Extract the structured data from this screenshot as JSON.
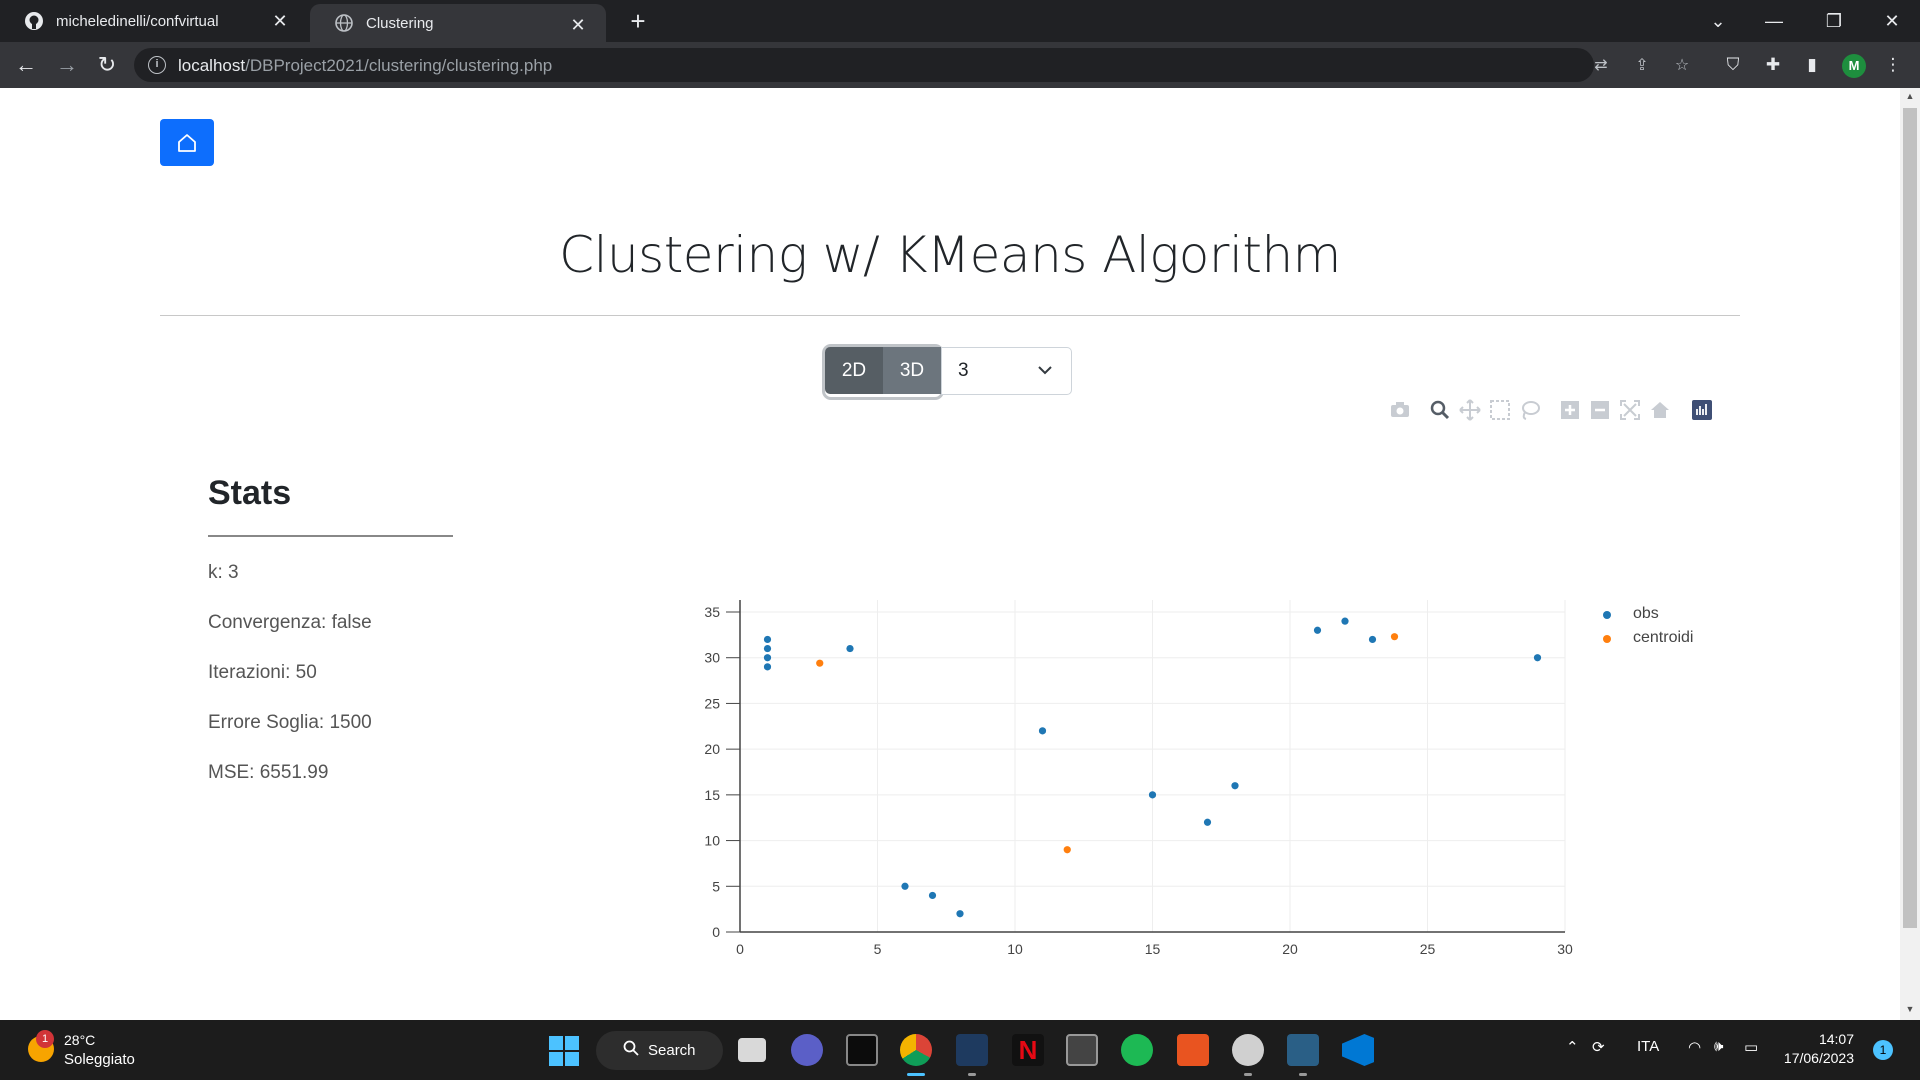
{
  "browser": {
    "tabs": [
      {
        "title": "micheledinelli/confvirtual",
        "icon": "github-icon"
      },
      {
        "title": "Clustering",
        "icon": "globe-icon"
      }
    ],
    "url_host": "localhost",
    "url_path": "/DBProject2021/clustering/clustering.php",
    "profile_initial": "M"
  },
  "page": {
    "title": "Clustering w/ KMeans Algorithm",
    "mode_buttons": {
      "btn_2d": "2D",
      "btn_3d": "3D"
    },
    "k_select_value": "3",
    "stats": {
      "heading": "Stats",
      "k": "k: 3",
      "convergenza": "Convergenza: false",
      "iterazioni": "Iterazioni: 50",
      "errore_soglia": "Errore Soglia: 1500",
      "mse": "MSE: 6551.99"
    }
  },
  "chart_data": {
    "type": "scatter",
    "xlim": [
      0,
      30
    ],
    "ylim": [
      0,
      35
    ],
    "x_ticks": [
      "0",
      "5",
      "10",
      "15",
      "20",
      "25",
      "30"
    ],
    "y_ticks": [
      "0",
      "5",
      "10",
      "15",
      "20",
      "25",
      "30",
      "35"
    ],
    "grid": true,
    "legend_position": "top-right",
    "series": [
      {
        "name": "obs",
        "color": "#1f77b4",
        "points": [
          [
            1,
            29
          ],
          [
            1,
            30
          ],
          [
            1,
            31
          ],
          [
            1,
            32
          ],
          [
            4,
            31
          ],
          [
            6,
            5
          ],
          [
            7,
            4
          ],
          [
            8,
            2
          ],
          [
            11,
            22
          ],
          [
            15,
            15
          ],
          [
            17,
            12
          ],
          [
            18,
            16
          ],
          [
            21,
            33
          ],
          [
            22,
            34
          ],
          [
            23,
            32
          ],
          [
            29,
            30
          ]
        ]
      },
      {
        "name": "centroidi",
        "color": "#ff7f0e",
        "points": [
          [
            2.9,
            29.4
          ],
          [
            11.9,
            9
          ],
          [
            23.8,
            32.3
          ]
        ]
      }
    ]
  },
  "taskbar": {
    "weather_temp": "28°C",
    "weather_cond": "Soleggiato",
    "weather_badge": "1",
    "search_label": "Search",
    "language": "ITA",
    "time": "14:07",
    "date": "17/06/2023",
    "notifications": "1"
  }
}
